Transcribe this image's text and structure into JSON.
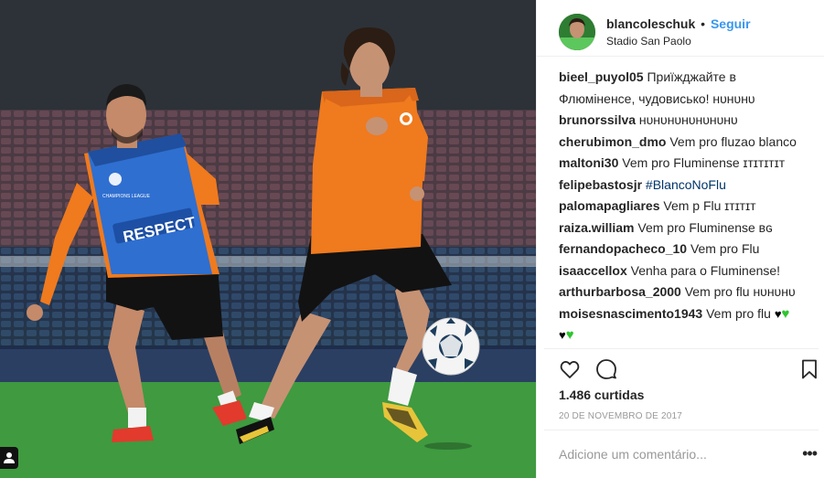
{
  "post": {
    "username": "blancoleschuk",
    "separator": "•",
    "follow_label": "Seguir",
    "location": "Stadio San Paolo",
    "likes": "1.486 curtidas",
    "date": "20 DE NOVEMBRO DE 2017",
    "add_comment_placeholder": "Adicione um comentário...",
    "more_label": "•••"
  },
  "photo": {
    "bib_text": "RESPECT",
    "bib_logo_text": "CHAMPIONS LEAGUE"
  },
  "comments": [
    {
      "user": "bieel_puyol05",
      "text": "Приїжджайте в Флюміненсе, чудовисько! ʜᴜʜᴜʜᴜ"
    },
    {
      "user": "brunorssilva",
      "text": "ʜᴜʜᴜʜᴜʜᴜʜᴜʜᴜʜᴜ"
    },
    {
      "user": "cherubimon_dmo",
      "text": "Vem pro fluzao blanco"
    },
    {
      "user": "maltoni30",
      "text": "Vem pro Fluminense ɪᴛɪᴛɪᴛɪᴛ"
    },
    {
      "user": "felipebastosjr",
      "text": "#BlancoNoFlu"
    },
    {
      "user": "palomapagliares",
      "text": "Vem p Flu ɪᴛɪᴛɪᴛ"
    },
    {
      "user": "raiza.william",
      "text": "Vem pro Fluminense ʙɢ"
    },
    {
      "user": "fernandopacheco_10",
      "text": "Vem pro Flu"
    },
    {
      "user": "isaaccellox",
      "text": "Venha para o Fluminense!"
    },
    {
      "user": "arthurbarbosa_2000",
      "text": "Vem pro flu ʜᴜʜᴜʜᴜ"
    },
    {
      "user": "moisesnascimento1943",
      "text": "Vem pro flu"
    }
  ],
  "icons": {
    "like": "heart-icon",
    "comment": "comment-bubble-icon",
    "save": "bookmark-icon",
    "photo_tag": "user-tag-icon"
  },
  "colors": {
    "follow": "#3897f0",
    "hashtag": "#003569",
    "green_heart": "#2ec52e",
    "jersey_orange": "#f07a1e",
    "bib_blue": "#2f6fd0"
  }
}
